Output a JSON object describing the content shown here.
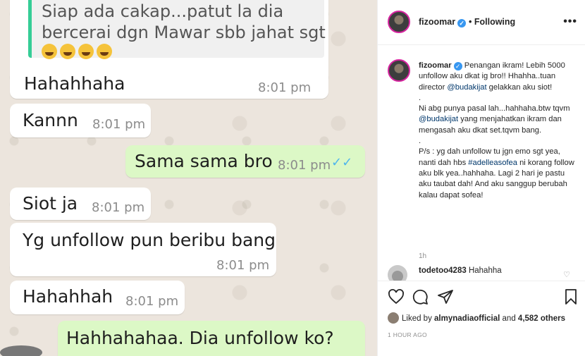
{
  "chat": {
    "quoted": {
      "line1": "Siap ada cakap...patut  la dia",
      "line2": "bercerai dgn Mawar sbb jahat sgt"
    },
    "messages": [
      {
        "text": "Hahahhaha",
        "time": "8:01 pm"
      },
      {
        "text": "Kannn",
        "time": "8:01 pm"
      },
      {
        "text": "Sama sama bro",
        "time": "8:01 pm"
      },
      {
        "text": "Siot ja",
        "time": "8:01 pm"
      },
      {
        "text": "Yg unfollow pun beribu bang",
        "time": "8:01 pm"
      },
      {
        "text": "Hahahhah",
        "time": "8:01 pm"
      },
      {
        "text": "Hahhahahaa. Dia unfollow ko?",
        "time": ""
      }
    ]
  },
  "instagram": {
    "header": {
      "username": "fizoomar",
      "following": "• Following",
      "more": "•••"
    },
    "caption": {
      "username": "fizoomar",
      "line1": "Penangan ikram! Lebih 5000 unfollow aku dkat ig bro!! Hhahha..tuan director ",
      "tag1": "@budakijat",
      "line1b": " gelakkan aku siot!",
      "dot1": ".",
      "line2a": "Ni abg punya pasal lah...hahhaha.btw tqvm ",
      "tag2": "@budakijat",
      "line2b": " yang menjahatkan ikram dan mengasah aku dkat set.tqvm bang.",
      "dot2": ".",
      "line3a": "P/s : yg dah unfollow tu jgn emo sgt yea, nanti dah hbs ",
      "tag3": "#adelleasofea",
      "line3b": " ni korang follow aku blk yea..hahhaha. Lagi 2 hari je pastu aku taubat dah! And aku sanggup berubah kalau dapat sofea!"
    },
    "caption_age": "1h",
    "comment": {
      "username": "todetoo4283",
      "text": "Hahahha"
    },
    "likes": {
      "prefix": "Liked by ",
      "user": "almynadiaofficial",
      "middle": " and ",
      "count": "4,582 others"
    },
    "time_ago": "1 HOUR AGO"
  }
}
